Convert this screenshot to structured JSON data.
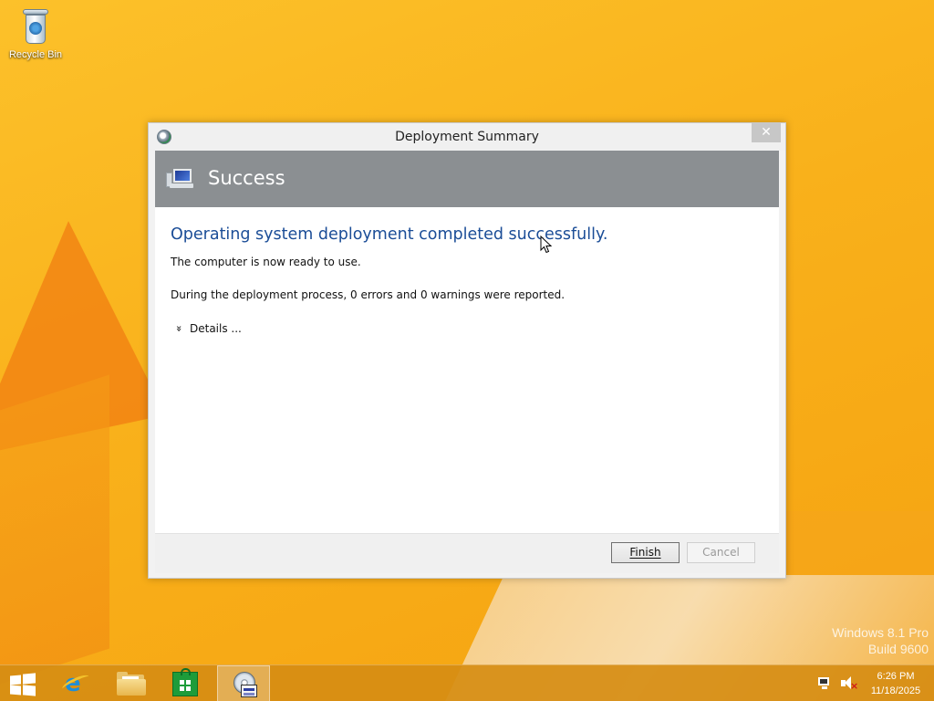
{
  "desktop": {
    "icons": [
      {
        "label": "Recycle Bin",
        "icon": "recycle-bin-icon"
      }
    ],
    "watermark": {
      "line1": "Windows 8.1 Pro",
      "line2": "Build 9600"
    }
  },
  "dialog": {
    "title": "Deployment Summary",
    "close_glyph": "✕",
    "banner": {
      "heading": "Success",
      "icon": "computer-icon"
    },
    "content": {
      "headline": "Operating system deployment completed successfully.",
      "line1": "The computer is now ready to use.",
      "line2": "During the deployment process, 0 errors and 0 warnings were reported.",
      "details_label": "Details ...",
      "details_glyph": "»"
    },
    "buttons": {
      "finish": "Finish",
      "cancel": "Cancel"
    }
  },
  "taskbar": {
    "items": [
      {
        "name": "start",
        "icon": "windows-logo-icon"
      },
      {
        "name": "internet-explorer",
        "icon": "internet-explorer-icon"
      },
      {
        "name": "file-explorer",
        "icon": "folder-icon"
      },
      {
        "name": "store",
        "icon": "store-icon"
      },
      {
        "name": "deployment-wizard",
        "icon": "dvd-install-icon",
        "active": true
      }
    ],
    "tray": {
      "network_icon": "network-icon",
      "volume_icon": "volume-muted-icon",
      "time": "6:26 PM",
      "date": "11/18/2025"
    }
  },
  "colors": {
    "desktop_background": "#f7a70e",
    "banner": "#8b8f92",
    "headline_text": "#1b4d97"
  }
}
